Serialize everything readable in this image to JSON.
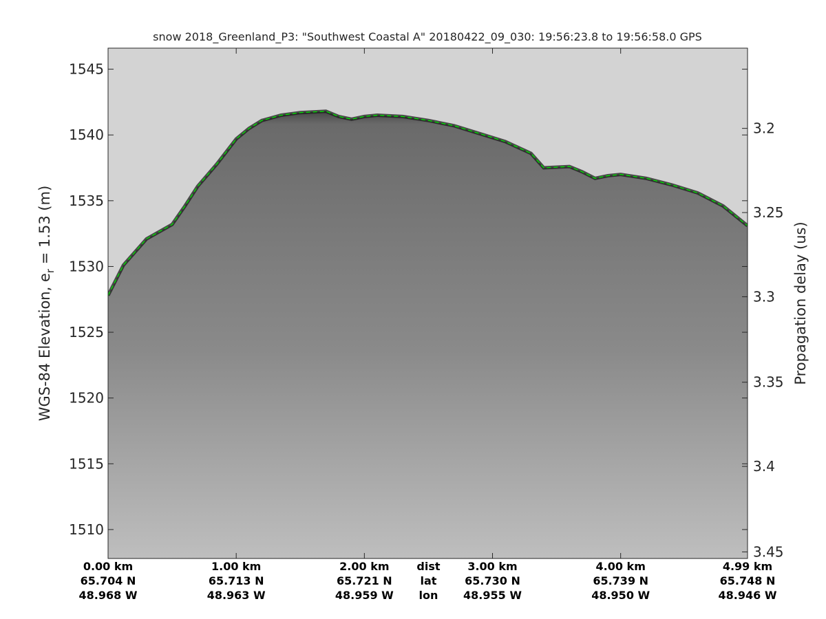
{
  "chart_data": {
    "type": "radar-echogram",
    "title": "snow 2018_Greenland_P3: \"Southwest Coastal A\"  20180422_09_030: 19:56:23.8 to 19:56:58.0 GPS",
    "ylabel_main": "WGS-84 Elevation, e",
    "ylabel_sub": "r",
    "ylabel_tail": " = 1.53 (m)",
    "y2label": "Propagation delay (us)",
    "ylim": [
      1507.8,
      1546.6
    ],
    "yticks": [
      1510,
      1515,
      1520,
      1525,
      1530,
      1535,
      1540,
      1545
    ],
    "y2ticks": [
      {
        "label": "3.2",
        "elev": 1540.5
      },
      {
        "label": "3.25",
        "elev": 1534.1
      },
      {
        "label": "3.3",
        "elev": 1527.7
      },
      {
        "label": "3.35",
        "elev": 1521.2
      },
      {
        "label": "3.4",
        "elev": 1514.8
      },
      {
        "label": "3.45",
        "elev": 1508.3
      }
    ],
    "xlim": [
      0,
      4.99
    ],
    "x_rows": [
      {
        "positions": [
          0,
          1,
          2,
          3,
          4,
          4.99
        ],
        "labels": [
          "0.00 km",
          "1.00 km",
          "2.00 km",
          "3.00 km",
          "4.00 km",
          "4.99 km"
        ]
      },
      {
        "positions": [
          0,
          1,
          2,
          3,
          4,
          4.99
        ],
        "labels": [
          "65.704 N",
          "65.713 N",
          "65.721 N",
          "65.730 N",
          "65.739 N",
          "65.748 N"
        ]
      },
      {
        "positions": [
          0,
          1,
          2,
          3,
          4,
          4.99
        ],
        "labels": [
          "48.968 W",
          "48.963 W",
          "48.959 W",
          "48.955 W",
          "48.950 W",
          "48.946 W"
        ]
      }
    ],
    "row_names": [
      "dist",
      "lat",
      "lon"
    ],
    "row_names_x": 2.5,
    "surface": {
      "x": [
        0,
        0.12,
        0.3,
        0.5,
        0.6,
        0.7,
        0.85,
        1.0,
        1.1,
        1.2,
        1.35,
        1.5,
        1.7,
        1.8,
        1.9,
        2.0,
        2.1,
        2.3,
        2.5,
        2.7,
        2.9,
        3.1,
        3.3,
        3.4,
        3.6,
        3.7,
        3.8,
        3.9,
        4.0,
        4.2,
        4.4,
        4.6,
        4.8,
        4.99
      ],
      "elev": [
        1527.8,
        1530.1,
        1532.1,
        1533.2,
        1534.6,
        1536.1,
        1537.8,
        1539.7,
        1540.5,
        1541.1,
        1541.5,
        1541.7,
        1541.8,
        1541.4,
        1541.2,
        1541.4,
        1541.5,
        1541.4,
        1541.1,
        1540.7,
        1540.1,
        1539.5,
        1538.6,
        1537.5,
        1537.6,
        1537.2,
        1536.7,
        1536.9,
        1537.0,
        1536.7,
        1536.2,
        1535.6,
        1534.6,
        1533.1
      ]
    },
    "colors": {
      "background": "#ffffff",
      "air": "#d3d3d3",
      "surface_edge": "#1c1c1c",
      "subsurface": "#6a6a6a",
      "deep": "#bebebe",
      "layer_line": "#00dd00"
    },
    "grid": false,
    "colormap": "gray"
  }
}
